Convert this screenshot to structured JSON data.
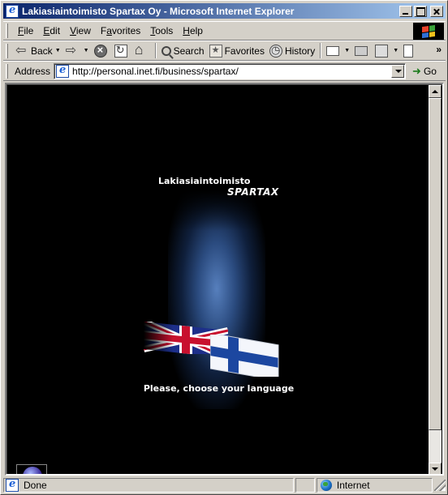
{
  "window": {
    "title": "Lakiasiaintoimisto Spartax Oy - Microsoft Internet Explorer"
  },
  "menu": {
    "items": [
      {
        "label": "File",
        "key": "F"
      },
      {
        "label": "Edit",
        "key": "E"
      },
      {
        "label": "View",
        "key": "V"
      },
      {
        "label": "Favorites",
        "key": "a"
      },
      {
        "label": "Tools",
        "key": "T"
      },
      {
        "label": "Help",
        "key": "H"
      }
    ]
  },
  "toolbar": {
    "back_label": "Back",
    "search_label": "Search",
    "favorites_label": "Favorites",
    "history_label": "History"
  },
  "address": {
    "label": "Address",
    "url": "http://personal.inet.fi/business/spartax/",
    "go_label": "Go"
  },
  "page": {
    "brand_small": "Lakiasiaintoimisto",
    "brand_big": "SPARTAX",
    "prompt": "Please, choose your language"
  },
  "status": {
    "text": "Done",
    "zone": "Internet"
  },
  "colors": {
    "titlebar_start": "#0a246a",
    "titlebar_end": "#a6caf0",
    "chrome": "#d4d0c8",
    "page_background": "#000000",
    "glow": "#5b86c7"
  },
  "icons": {
    "app": "ie-icon",
    "back": "back-arrow-icon",
    "forward": "forward-arrow-icon",
    "stop": "stop-icon",
    "refresh": "refresh-icon",
    "home": "home-icon",
    "search": "search-icon",
    "favorites": "favorites-icon",
    "history": "history-icon",
    "mail": "mail-icon",
    "print": "print-icon",
    "edit": "edit-icon",
    "discuss": "discuss-icon",
    "go": "go-arrow-icon",
    "zone": "globe-icon"
  }
}
